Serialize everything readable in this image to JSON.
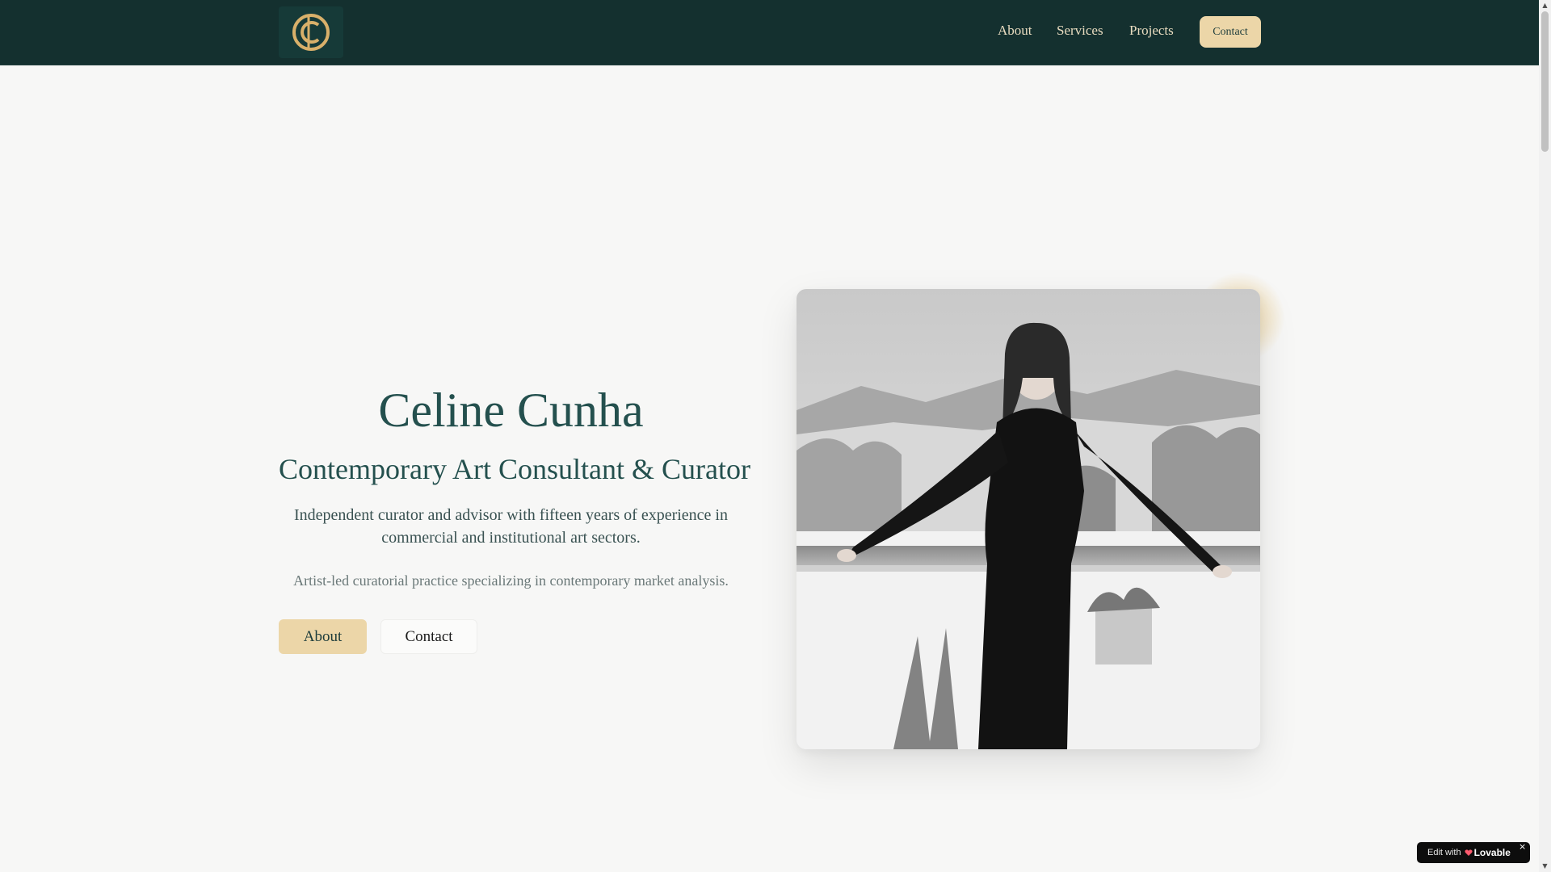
{
  "header": {
    "logo_alt": "CC monogram logo",
    "nav": [
      "About",
      "Services",
      "Projects"
    ],
    "contact_label": "Contact"
  },
  "hero": {
    "name": "Celine Cunha",
    "role": "Contemporary Art Consultant & Curator",
    "description": "Independent curator and advisor with fifteen years of experience in commercial and institutional art sectors.",
    "note": "Artist-led curatorial practice specializing in contemporary market analysis.",
    "buttons": {
      "about": "About",
      "contact": "Contact"
    }
  },
  "portrait": {
    "description": "Black and white photo of a woman in a black dress standing in a snowy landscape"
  },
  "badge": {
    "edit_with": "Edit with",
    "brand": "Lovable",
    "close": "×"
  },
  "colors": {
    "header_bg": "#14302f",
    "accent_gold": "#ecd6a8",
    "heading_teal": "#24504e",
    "page_bg": "#f7f7f6"
  }
}
